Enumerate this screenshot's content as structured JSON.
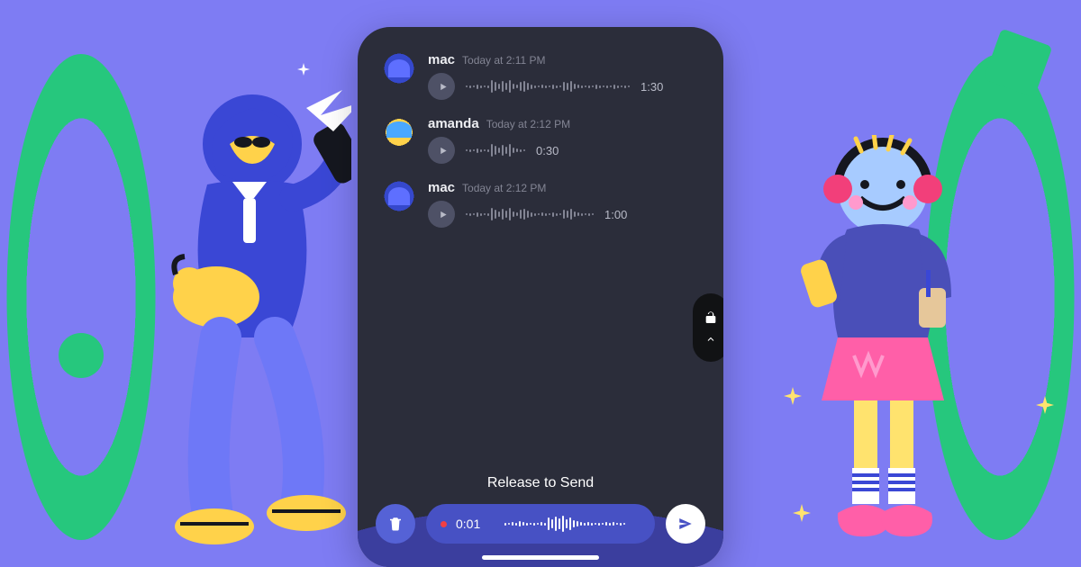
{
  "colors": {
    "background": "#7E7CF3",
    "panel": "#2B2D3A",
    "accent": "#4751C4",
    "green": "#26C77D",
    "yellow": "#FFD24A"
  },
  "messages": [
    {
      "user": "mac",
      "avatar": "mac",
      "time": "Today at 2:11 PM",
      "duration": "1:30",
      "wave": [
        2,
        3,
        2,
        5,
        3,
        2,
        3,
        14,
        10,
        6,
        12,
        8,
        14,
        6,
        4,
        10,
        12,
        8,
        5,
        3,
        2,
        4,
        3,
        2,
        5,
        3,
        2,
        10,
        8,
        12,
        6,
        4,
        3,
        2,
        3,
        2,
        5,
        3,
        2,
        3,
        2,
        5,
        3,
        2,
        3,
        2
      ]
    },
    {
      "user": "amanda",
      "avatar": "amanda",
      "time": "Today at 2:12 PM",
      "duration": "0:30",
      "wave": [
        2,
        3,
        2,
        5,
        3,
        2,
        3,
        14,
        10,
        6,
        12,
        8,
        14,
        6,
        4,
        3,
        2
      ]
    },
    {
      "user": "mac",
      "avatar": "mac",
      "time": "Today at 2:12 PM",
      "duration": "1:00",
      "wave": [
        2,
        3,
        2,
        5,
        3,
        2,
        3,
        14,
        10,
        6,
        12,
        8,
        14,
        6,
        4,
        10,
        12,
        8,
        5,
        3,
        2,
        4,
        3,
        2,
        5,
        3,
        2,
        10,
        8,
        12,
        6,
        4,
        3,
        2,
        3,
        2
      ]
    }
  ],
  "recorder": {
    "label": "Release to Send",
    "time": "0:01",
    "wave": [
      3,
      2,
      4,
      3,
      6,
      4,
      3,
      2,
      3,
      2,
      4,
      3,
      14,
      10,
      16,
      12,
      18,
      10,
      14,
      8,
      6,
      4,
      3,
      4,
      3,
      2,
      3,
      2,
      4,
      3,
      4,
      2,
      3,
      2
    ]
  }
}
